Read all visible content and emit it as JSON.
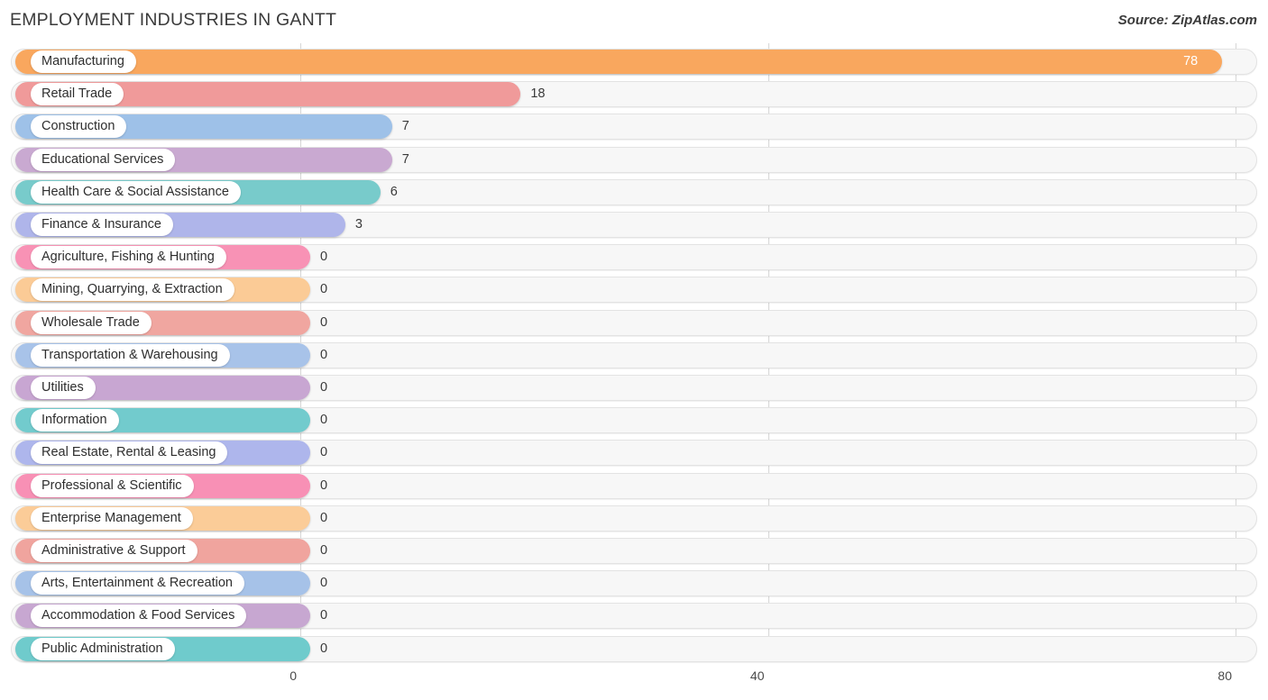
{
  "header": {
    "title": "EMPLOYMENT INDUSTRIES IN GANTT",
    "source": "Source: ZipAtlas.com"
  },
  "chart_data": {
    "type": "bar",
    "orientation": "horizontal",
    "title": "EMPLOYMENT INDUSTRIES IN GANTT",
    "xlabel": "",
    "ylabel": "",
    "xlim": [
      0,
      80
    ],
    "xticks": [
      0,
      40,
      80
    ],
    "xtick_labels": [
      "0",
      "40",
      "80"
    ],
    "grid": true,
    "legend": false,
    "categories": [
      "Manufacturing",
      "Retail Trade",
      "Construction",
      "Educational Services",
      "Health Care & Social Assistance",
      "Finance & Insurance",
      "Agriculture, Fishing & Hunting",
      "Mining, Quarrying, & Extraction",
      "Wholesale Trade",
      "Transportation & Warehousing",
      "Utilities",
      "Information",
      "Real Estate, Rental & Leasing",
      "Professional & Scientific",
      "Enterprise Management",
      "Administrative & Support",
      "Arts, Entertainment & Recreation",
      "Accommodation & Food Services",
      "Public Administration"
    ],
    "values": [
      78,
      18,
      7,
      7,
      6,
      3,
      0,
      0,
      0,
      0,
      0,
      0,
      0,
      0,
      0,
      0,
      0,
      0,
      0
    ],
    "value_labels": [
      "78",
      "18",
      "7",
      "7",
      "6",
      "3",
      "0",
      "0",
      "0",
      "0",
      "0",
      "0",
      "0",
      "0",
      "0",
      "0",
      "0",
      "0",
      "0"
    ],
    "colors": [
      "#F9A75E",
      "#F09A9A",
      "#9EC1E8",
      "#C9A9D1",
      "#78CBCB",
      "#AFB5EA",
      "#F892B5",
      "#FBCB96",
      "#F0A6A0",
      "#A8C3E9",
      "#C8A6D2",
      "#72CBCD",
      "#AEB6EC",
      "#F890B5",
      "#FBCC98",
      "#F0A49E",
      "#A6C2E8",
      "#C7A7D1",
      "#6FCBCC"
    ]
  }
}
